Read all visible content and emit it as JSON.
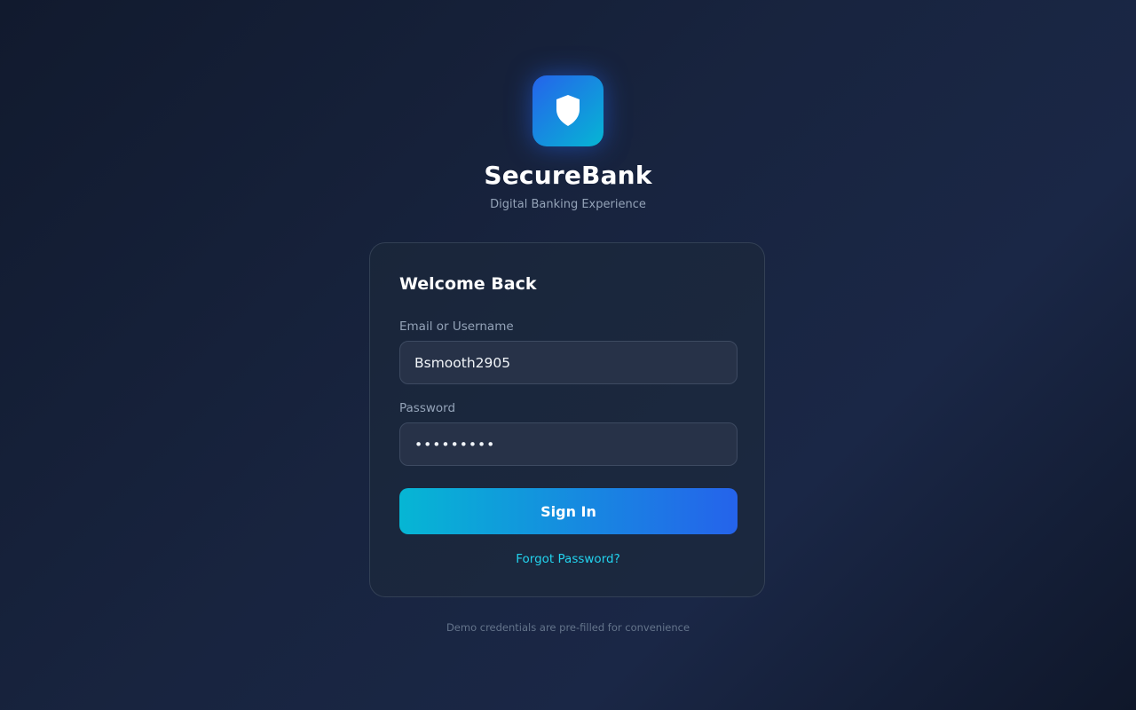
{
  "brand": {
    "name": "SecureBank",
    "tagline": "Digital Banking Experience",
    "icon": "shield-icon",
    "accent_start": "#2563eb",
    "accent_end": "#06b6d4"
  },
  "login_card": {
    "title": "Welcome Back",
    "email_label": "Email or Username",
    "email_value": "Bsmooth2905",
    "password_label": "Password",
    "password_value": "•••••••••",
    "signin_label": "Sign In",
    "forgot_label": "Forgot Password?"
  },
  "footer": {
    "note": "Demo credentials are pre-filled for convenience"
  },
  "colors": {
    "background": "#111a2e",
    "link": "#22d3ee",
    "button_gradient_start": "#06b6d4",
    "button_gradient_end": "#2563eb"
  }
}
